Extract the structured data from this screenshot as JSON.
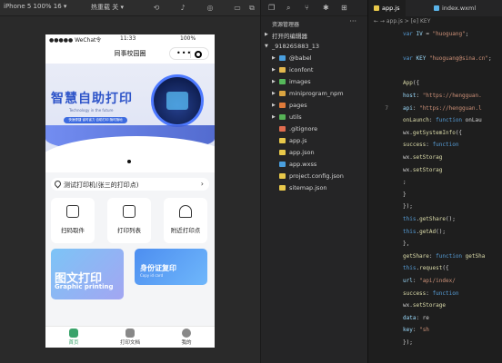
{
  "toolbar": {
    "device": "iPhone 5 100% 16 ▾",
    "mode": "热重载 关 ▾"
  },
  "phone": {
    "status": {
      "carrier": "●●●●● WeChat令",
      "time": "11:33",
      "battery": "100%"
    },
    "nav_title": "同事校园圈",
    "banner": {
      "headline": "智慧自助打印",
      "subtitle": "Technology in the future",
      "pill": "快速便捷 省时省力 自助打印 随时随地"
    },
    "location": "测试打印机(张三的打印点)",
    "grid": [
      {
        "label": "扫码取件",
        "icon": "scan-icon"
      },
      {
        "label": "打印列表",
        "icon": "list-icon"
      },
      {
        "label": "附近打印点",
        "icon": "home-icon"
      }
    ],
    "card1": {
      "title": "图文打印",
      "subtitle": "Graphic printing"
    },
    "card2": {
      "title": "身份证复印",
      "subtitle": "Copy id card"
    },
    "tabs": [
      {
        "label": "首页",
        "icon": "home-tab-icon"
      },
      {
        "label": "打印文档",
        "icon": "doc-tab-icon"
      },
      {
        "label": "我的",
        "icon": "user-tab-icon"
      }
    ]
  },
  "explorer": {
    "header": "资源管理器",
    "open_editors": "打开的编辑器",
    "project": "_918265883_13",
    "items": [
      {
        "label": "@babel",
        "type": "folder",
        "color": "#4a9fde"
      },
      {
        "label": "iconfont",
        "type": "folder",
        "color": "#e4b84e"
      },
      {
        "label": "images",
        "type": "folder",
        "color": "#55b85a"
      },
      {
        "label": "miniprogram_npm",
        "type": "folder",
        "color": "#d9a441"
      },
      {
        "label": "pages",
        "type": "folder",
        "color": "#e07b3a"
      },
      {
        "label": "utils",
        "type": "folder",
        "color": "#56b356"
      },
      {
        "label": ".gitignore",
        "type": "file",
        "color": "#e06c4f"
      },
      {
        "label": "app.js",
        "type": "file",
        "color": "#e8c84a"
      },
      {
        "label": "app.json",
        "type": "file",
        "color": "#e8c84a"
      },
      {
        "label": "app.wxss",
        "type": "file",
        "color": "#4a9fde"
      },
      {
        "label": "project.config.json",
        "type": "file",
        "color": "#e8c84a"
      },
      {
        "label": "sitemap.json",
        "type": "file",
        "color": "#e8c84a"
      }
    ]
  },
  "editor": {
    "tabs": [
      "app.js",
      "index.wxml"
    ],
    "crumb": "← →  app.js > [e] KEY",
    "lines": [
      {
        "n": "",
        "html": "<span class='k'>var</span> <span class='p'>IV</span> = <span class='s'>\"huoguang\"</span>;"
      },
      {
        "n": "",
        "html": ""
      },
      {
        "n": "",
        "html": "<span class='k'>var</span> <span class='p'>KEY</span>  <span class='s'>\"huoguang@sina.cn\"</span>;"
      },
      {
        "n": "",
        "html": ""
      },
      {
        "n": "",
        "html": "<span class='f'>App</span>({"
      },
      {
        "n": "",
        "html": "  <span class='p'>host</span>: <span class='s'>\"https://hengguan.</span>"
      },
      {
        "n": "7",
        "html": "  <span class='p'>api</span>: <span class='s'>\"https://hengguan.l</span>"
      },
      {
        "n": "",
        "html": "  <span class='f'>onLaunch</span>: <span class='k'>function</span> onLau"
      },
      {
        "n": "",
        "html": "    wx.<span class='f'>getSystemInfo</span>({"
      },
      {
        "n": "",
        "html": "      <span class='f'>success</span>: <span class='k'>function</span>"
      },
      {
        "n": "",
        "html": "        wx.<span class='f'>setStorag</span>"
      },
      {
        "n": "",
        "html": "        wx.<span class='f'>setStorag</span>"
      },
      {
        "n": "",
        "html": "        ;"
      },
      {
        "n": "",
        "html": "      }"
      },
      {
        "n": "",
        "html": "    });"
      },
      {
        "n": "",
        "html": "    <span class='k'>this</span>.<span class='f'>getShare</span>();"
      },
      {
        "n": "",
        "html": "    <span class='k'>this</span>.<span class='f'>getAd</span>();"
      },
      {
        "n": "",
        "html": "  },"
      },
      {
        "n": "",
        "html": "  <span class='f'>getShare</span>: <span class='k'>function</span> <span class='f'>getSha</span>"
      },
      {
        "n": "",
        "html": "    <span class='k'>this</span>.<span class='f'>request</span>({"
      },
      {
        "n": "",
        "html": "      <span class='p'>url</span>: <span class='s'>\"api/index/</span>"
      },
      {
        "n": "",
        "html": "      <span class='f'>success</span>: <span class='k'>function</span>"
      },
      {
        "n": "",
        "html": "        wx.<span class='f'>setStorage</span>"
      },
      {
        "n": "",
        "html": "          <span class='p'>data</span>: re"
      },
      {
        "n": "",
        "html": "          <span class='p'>key</span>: <span class='s'>\"sh</span>"
      },
      {
        "n": "",
        "html": "        });"
      }
    ]
  }
}
